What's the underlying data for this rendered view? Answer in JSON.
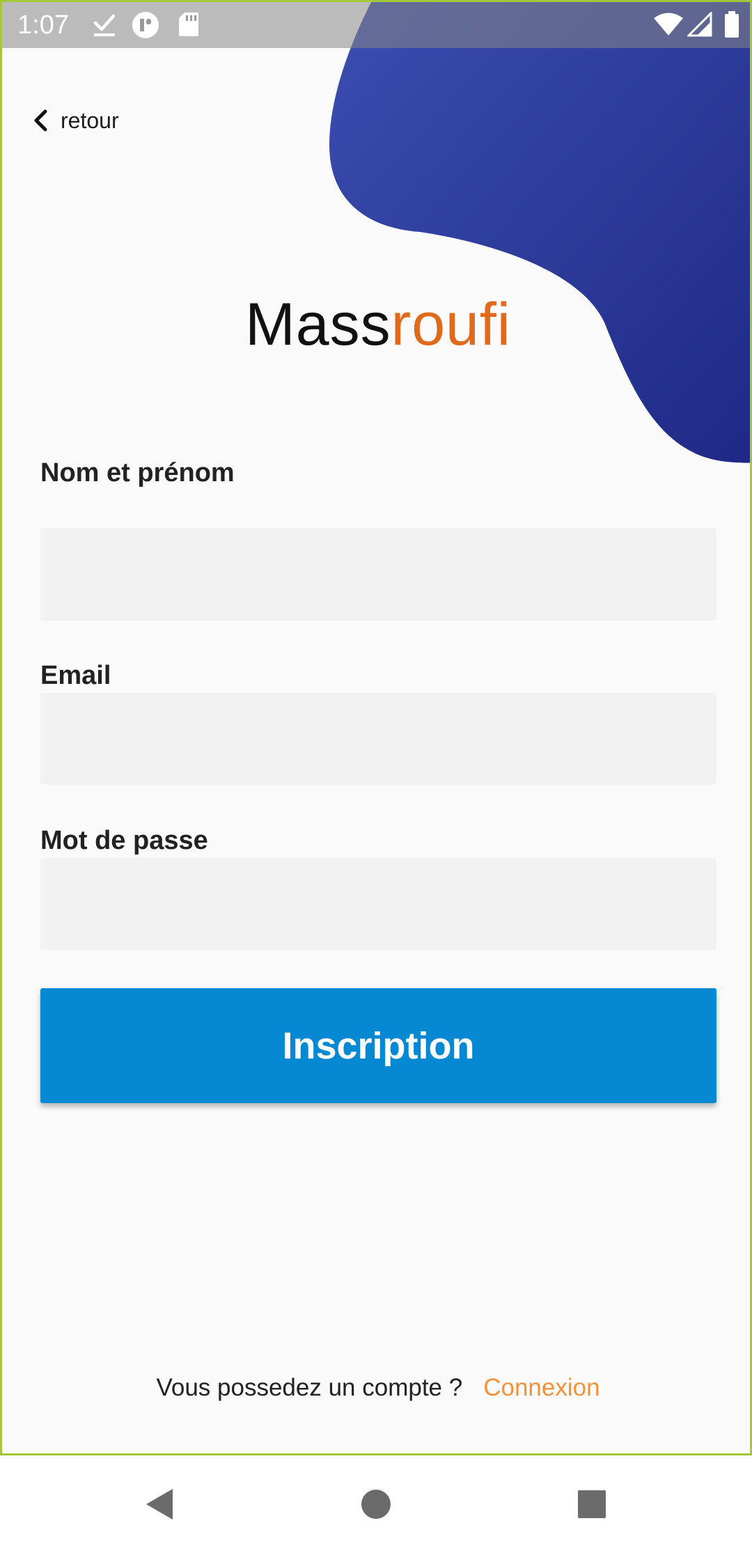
{
  "status_bar": {
    "time": "1:07",
    "icons": [
      "download-done-icon",
      "app-notification-icon",
      "sd-card-icon",
      "wifi-icon",
      "signal-icon",
      "battery-icon"
    ]
  },
  "header": {
    "back_label": "retour",
    "back_icon": "chevron-left-icon"
  },
  "logo": {
    "part1": "Mass",
    "part2": "roufi",
    "part1_color": "#111111",
    "part2_color": "#e06a1b"
  },
  "form": {
    "name_label": "Nom et prénom",
    "name_value": "",
    "email_label": "Email",
    "email_value": "",
    "password_label": "Mot de passe",
    "password_value": "",
    "submit_label": "Inscription"
  },
  "footer": {
    "prompt": "Vous possedez un compte ?",
    "login_link": "Connexion"
  },
  "colors": {
    "blob": "#2a3a9a",
    "button": "#0689d2",
    "link": "#f39237",
    "frame_border": "#a4c83a"
  },
  "nav_bar": {
    "icons": [
      "back-triangle-icon",
      "home-circle-icon",
      "recents-square-icon"
    ]
  }
}
